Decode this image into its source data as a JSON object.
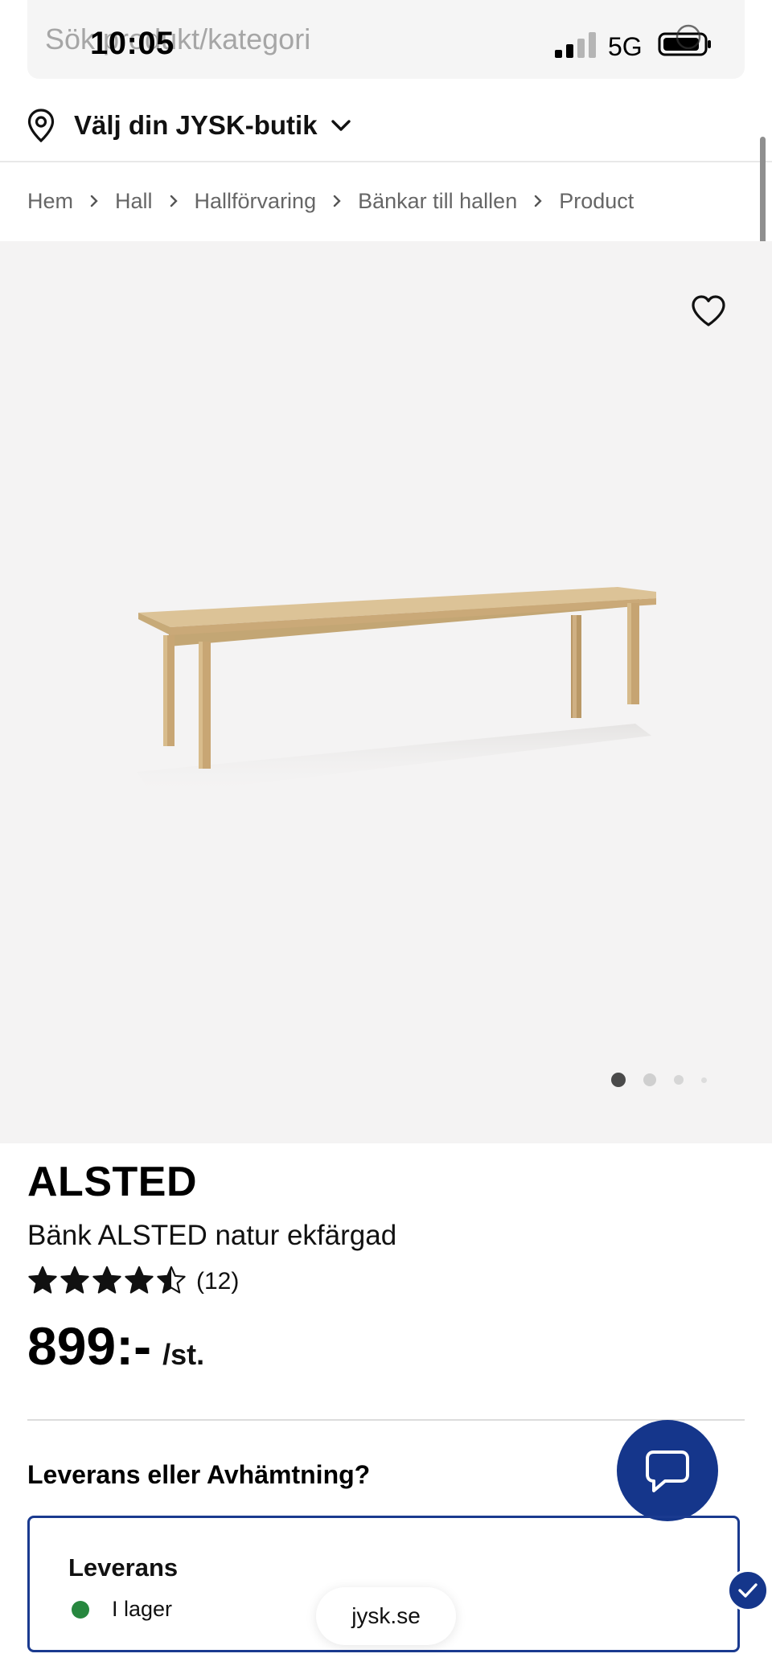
{
  "search": {
    "placeholder": "Sök produkt/kategori"
  },
  "status_bar": {
    "time": "10:05",
    "network": "5G",
    "signal_bars_active": 2,
    "signal_bars_total": 4
  },
  "store_selector": {
    "label": "Välj din JYSK-butik",
    "icon": "location-pin-icon"
  },
  "breadcrumb": {
    "items": [
      "Hem",
      "Hall",
      "Hallförvaring",
      "Bänkar till hallen",
      "Product"
    ]
  },
  "gallery": {
    "image_count": 4,
    "active_index": 0
  },
  "product": {
    "brand": "ALSTED",
    "name": "Bänk ALSTED natur ekfärgad",
    "rating": 4.5,
    "rating_max": 5,
    "review_count": "(12)",
    "price": "899:-",
    "unit": "/st."
  },
  "delivery": {
    "heading": "Leverans eller Avhämtning?",
    "option": {
      "title": "Leverans",
      "stock_status": "I lager",
      "selected": true
    }
  },
  "browser": {
    "url": "jysk.se"
  },
  "colors": {
    "brand_blue": "#15368b",
    "stock_green": "#27873f",
    "gallery_bg": "#f4f3f3"
  }
}
